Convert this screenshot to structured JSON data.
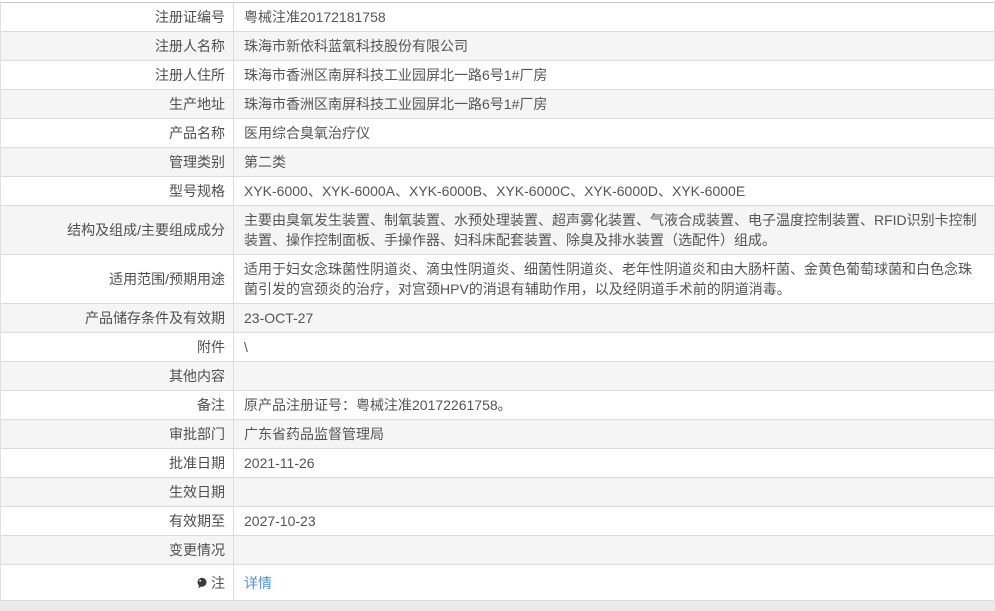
{
  "colors": {
    "link_blue": "#4f94db",
    "stripe_gray": "#f5f5f6",
    "border_gray": "#dcdcdc",
    "label_text": "#4f4f4f",
    "value_text": "#555555",
    "note_icon_dark": "#3a3a3a"
  },
  "icons": {
    "note": "speech-balloon-icon"
  },
  "table": {
    "rows": [
      {
        "label": "注册证编号",
        "value": "粤械注准20172181758"
      },
      {
        "label": "注册人名称",
        "value": "珠海市新依科蓝氧科技股份有限公司"
      },
      {
        "label": "注册人住所",
        "value": "珠海市香洲区南屏科技工业园屏北一路6号1#厂房"
      },
      {
        "label": "生产地址",
        "value": "珠海市香洲区南屏科技工业园屏北一路6号1#厂房"
      },
      {
        "label": "产品名称",
        "value": "医用综合臭氧治疗仪"
      },
      {
        "label": "管理类别",
        "value": "第二类"
      },
      {
        "label": "型号规格",
        "value": "XYK-6000、XYK-6000A、XYK-6000B、XYK-6000C、XYK-6000D、XYK-6000E"
      },
      {
        "label": "结构及组成/主要组成成分",
        "value": "主要由臭氧发生装置、制氧装置、水预处理装置、超声雾化装置、气液合成装置、电子温度控制装置、RFID识别卡控制装置、操作控制面板、手操作器、妇科床配套装置、除臭及排水装置（选配件）组成。"
      },
      {
        "label": "适用范围/预期用途",
        "value": "适用于妇女念珠菌性阴道炎、滴虫性阴道炎、细菌性阴道炎、老年性阴道炎和由大肠杆菌、金黄色葡萄球菌和白色念珠菌引发的宫颈炎的治疗，对宫颈HPV的消退有辅助作用，以及经阴道手术前的阴道消毒。"
      },
      {
        "label": "产品储存条件及有效期",
        "value": "23-OCT-27"
      },
      {
        "label": "附件",
        "value": "\\"
      },
      {
        "label": "其他内容",
        "value": ""
      },
      {
        "label": "备注",
        "value": "原产品注册证号：粤械注准20172261758。"
      },
      {
        "label": "审批部门",
        "value": "广东省药品监督管理局"
      },
      {
        "label": "批准日期",
        "value": "2021-11-26"
      },
      {
        "label": "生效日期",
        "value": ""
      },
      {
        "label": "有效期至",
        "value": "2027-10-23"
      },
      {
        "label": "变更情况",
        "value": ""
      },
      {
        "label": "注",
        "value": "详情",
        "type": "link",
        "icon": "speech-balloon-icon"
      }
    ]
  }
}
